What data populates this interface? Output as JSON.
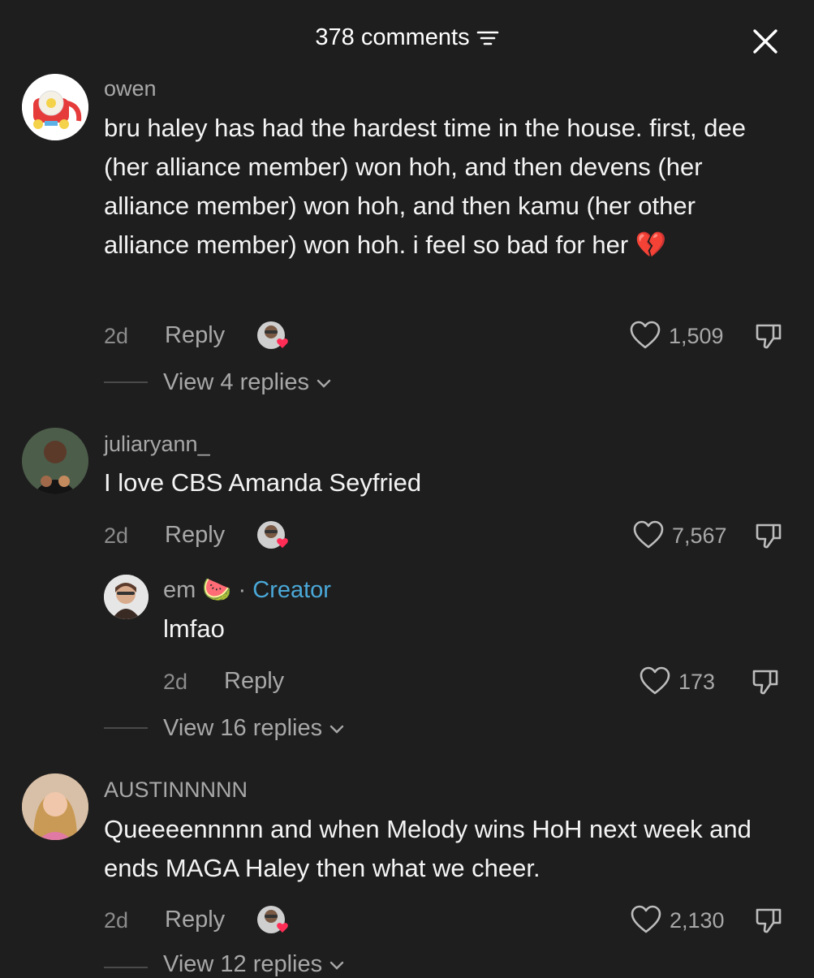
{
  "header": {
    "title": "378 comments",
    "filter_icon": "filter-icon",
    "close_icon": "close-icon"
  },
  "comments": [
    {
      "username": "owen",
      "text": "bru haley has had the hardest time in the house. first, dee (her alliance member) won hoh, and then devens (her alliance member) won hoh, and then kamu (her other alliance member) won hoh. i feel so bad for her",
      "emoji": "💔",
      "time": "2d",
      "reply_label": "Reply",
      "likes": "1,509",
      "view_replies": "View 4 replies"
    },
    {
      "username": "juliaryann_",
      "text": "I love CBS Amanda Seyfried",
      "time": "2d",
      "reply_label": "Reply",
      "likes": "7,567",
      "reply": {
        "username": "em",
        "emoji": "🍉",
        "separator": "·",
        "badge": "Creator",
        "text": "lmfao",
        "time": "2d",
        "reply_label": "Reply",
        "likes": "173"
      },
      "view_replies": "View 16 replies"
    },
    {
      "username": "AUSTINNNNN",
      "text": "Queeeennnnn and when Melody wins HoH next week and ends MAGA Haley then what we cheer.",
      "time": "2d",
      "reply_label": "Reply",
      "likes": "2,130",
      "view_replies": "View 12 replies"
    }
  ]
}
